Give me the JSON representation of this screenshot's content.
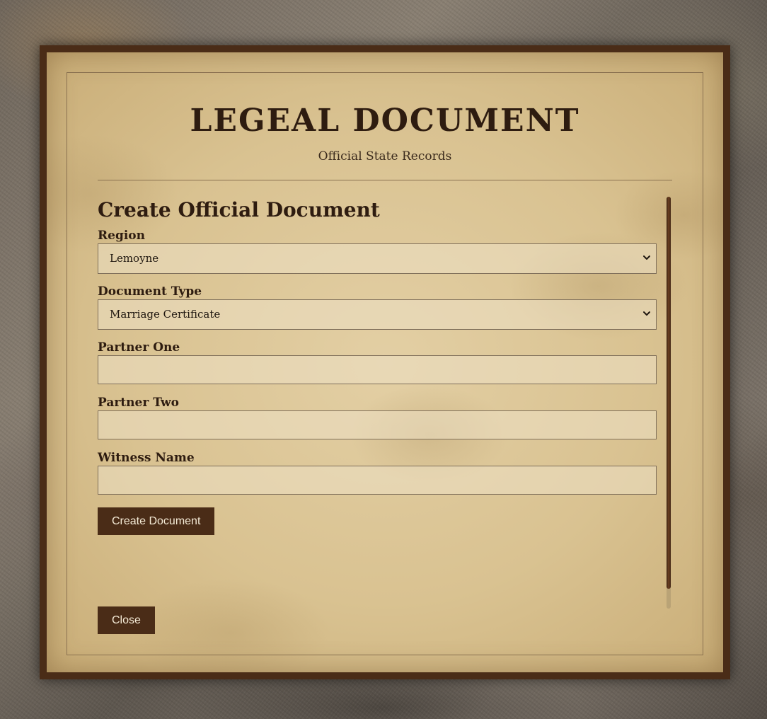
{
  "document": {
    "title": "LEGEAL DOCUMENT",
    "subtitle": "Official State Records"
  },
  "form": {
    "heading": "Create Official Document",
    "region": {
      "label": "Region",
      "selected": "Lemoyne"
    },
    "document_type": {
      "label": "Document Type",
      "selected": "Marriage Certificate"
    },
    "partner_one": {
      "label": "Partner One",
      "value": ""
    },
    "partner_two": {
      "label": "Partner Two",
      "value": ""
    },
    "witness_name": {
      "label": "Witness Name",
      "value": ""
    },
    "submit_label": "Create Document"
  },
  "footer": {
    "close_label": "Close"
  },
  "icons": {
    "dropdown": "chevron-down-icon"
  },
  "colors": {
    "frame": "#4a2c17",
    "paper": "#d9c291",
    "ink": "#2e1c10",
    "button_text": "#f4ead6"
  }
}
